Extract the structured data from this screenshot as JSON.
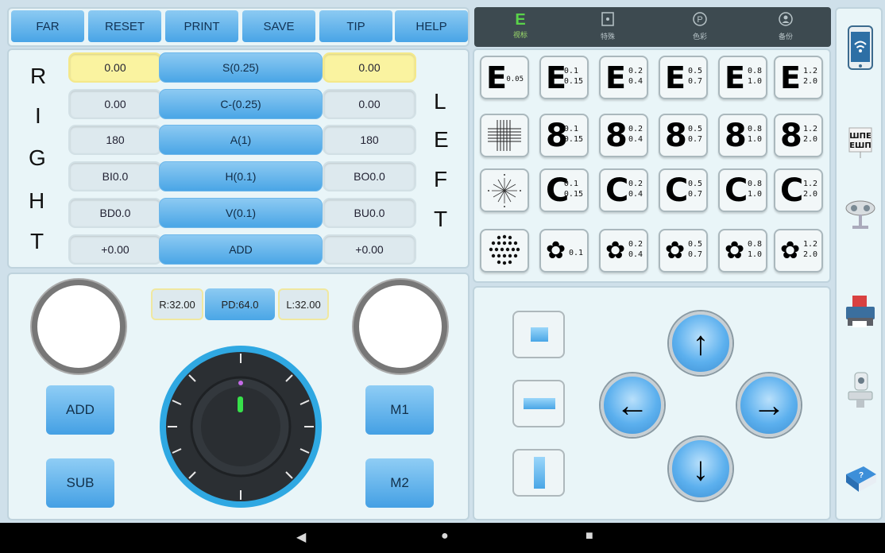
{
  "toolbar": {
    "buttons": [
      "FAR",
      "RESET",
      "PRINT",
      "SAVE",
      "TIP",
      "HELP"
    ]
  },
  "params": {
    "right_letters": [
      "R",
      "I",
      "G",
      "H",
      "T"
    ],
    "left_letters": [
      "L",
      "E",
      "F",
      "T"
    ],
    "rows": [
      {
        "right": "0.00",
        "label": "S(0.25)",
        "left": "0.00",
        "highlight": true
      },
      {
        "right": "0.00",
        "label": "C-(0.25)",
        "left": "0.00",
        "highlight": false
      },
      {
        "right": "180",
        "label": "A(1)",
        "left": "180",
        "highlight": false
      },
      {
        "right": "BI0.0",
        "label": "H(0.1)",
        "left": "BO0.0",
        "highlight": false
      },
      {
        "right": "BD0.0",
        "label": "V(0.1)",
        "left": "BU0.0",
        "highlight": false
      },
      {
        "right": "+0.00",
        "label": "ADD",
        "left": "+0.00",
        "highlight": false
      }
    ]
  },
  "pd": {
    "right": "R:32.00",
    "pd": "PD:64.0",
    "left": "L:32.00"
  },
  "control": {
    "add": "ADD",
    "sub": "SUB",
    "m1": "M1",
    "m2": "M2"
  },
  "tabs": [
    {
      "label": "视标",
      "icon": "E",
      "active": true
    },
    {
      "label": "特殊",
      "icon": "frame-icon",
      "active": false
    },
    {
      "label": "色彩",
      "icon": "P",
      "active": false
    },
    {
      "label": "备份",
      "icon": "person-icon",
      "active": false
    }
  ],
  "charts": [
    [
      {
        "glyph": "E",
        "nums": "0.05"
      },
      {
        "glyph": "E",
        "nums": "0.1\n0.15"
      },
      {
        "glyph": "E",
        "nums": "0.2\n0.4"
      },
      {
        "glyph": "E",
        "nums": "0.5\n0.7"
      },
      {
        "glyph": "E",
        "nums": "0.8\n1.0"
      },
      {
        "glyph": "E",
        "nums": "1.2\n2.0"
      }
    ],
    [
      {
        "glyph": "cross-grid",
        "nums": ""
      },
      {
        "glyph": "8",
        "nums": "0.1\n0.15"
      },
      {
        "glyph": "8",
        "nums": "0.2\n0.4"
      },
      {
        "glyph": "8",
        "nums": "0.5\n0.7"
      },
      {
        "glyph": "8",
        "nums": "0.8\n1.0"
      },
      {
        "glyph": "8",
        "nums": "1.2\n2.0"
      }
    ],
    [
      {
        "glyph": "astigmatism-dial",
        "nums": ""
      },
      {
        "glyph": "C",
        "nums": "0.1\n0.15"
      },
      {
        "glyph": "C",
        "nums": "0.2\n0.4"
      },
      {
        "glyph": "C",
        "nums": "0.5\n0.7"
      },
      {
        "glyph": "C",
        "nums": "0.8\n1.0"
      },
      {
        "glyph": "C",
        "nums": "1.2\n2.0"
      }
    ],
    [
      {
        "glyph": "dot-pattern",
        "nums": ""
      },
      {
        "glyph": "flower",
        "nums": "0.1"
      },
      {
        "glyph": "flower",
        "nums": "0.2\n0.4"
      },
      {
        "glyph": "flower",
        "nums": "0.5\n0.7"
      },
      {
        "glyph": "flower",
        "nums": "0.8\n1.0"
      },
      {
        "glyph": "flower",
        "nums": "1.2\n2.0"
      }
    ]
  ],
  "nav": {
    "back": "◀",
    "home": "●",
    "recents": "■"
  },
  "colors": {
    "accent": "#4aa6e6",
    "highlight": "#faf3a0",
    "dial_ring": "#2fa8e2"
  }
}
